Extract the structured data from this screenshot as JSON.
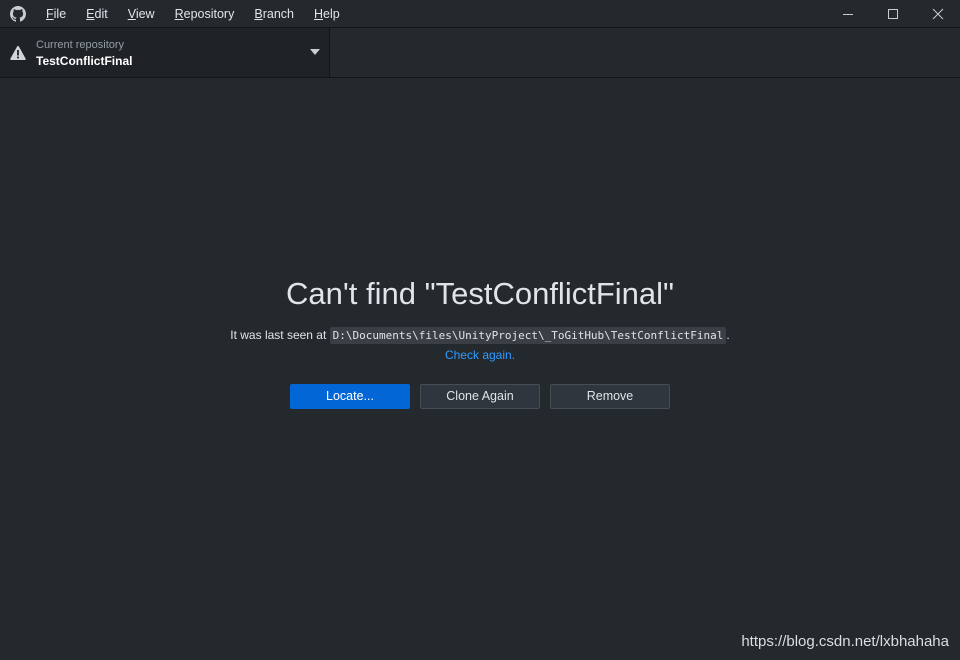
{
  "menu": {
    "items": [
      {
        "key": "F",
        "rest": "ile"
      },
      {
        "key": "E",
        "rest": "dit"
      },
      {
        "key": "V",
        "rest": "iew"
      },
      {
        "key": "R",
        "rest": "epository"
      },
      {
        "key": "B",
        "rest": "ranch"
      },
      {
        "key": "H",
        "rest": "elp"
      }
    ]
  },
  "toolbar": {
    "repo_label": "Current repository",
    "repo_name": "TestConflictFinal"
  },
  "main": {
    "headline": "Can't find \"TestConflictFinal\"",
    "last_seen_prefix": "It was last seen at ",
    "path": "D:\\Documents\\files\\UnityProject\\_ToGitHub\\TestConflictFinal",
    "last_seen_suffix": ".",
    "check_again": "Check again.",
    "locate_button": "Locate...",
    "clone_button": "Clone Again",
    "remove_button": "Remove"
  },
  "watermark": "https://blog.csdn.net/lxbhahaha",
  "colors": {
    "background": "#24292e",
    "primary": "#0366d6",
    "link": "#2f9bff"
  },
  "icons": [
    "github-logo-icon",
    "minimize-icon",
    "maximize-icon",
    "close-icon",
    "warning-icon",
    "caret-down-icon"
  ]
}
